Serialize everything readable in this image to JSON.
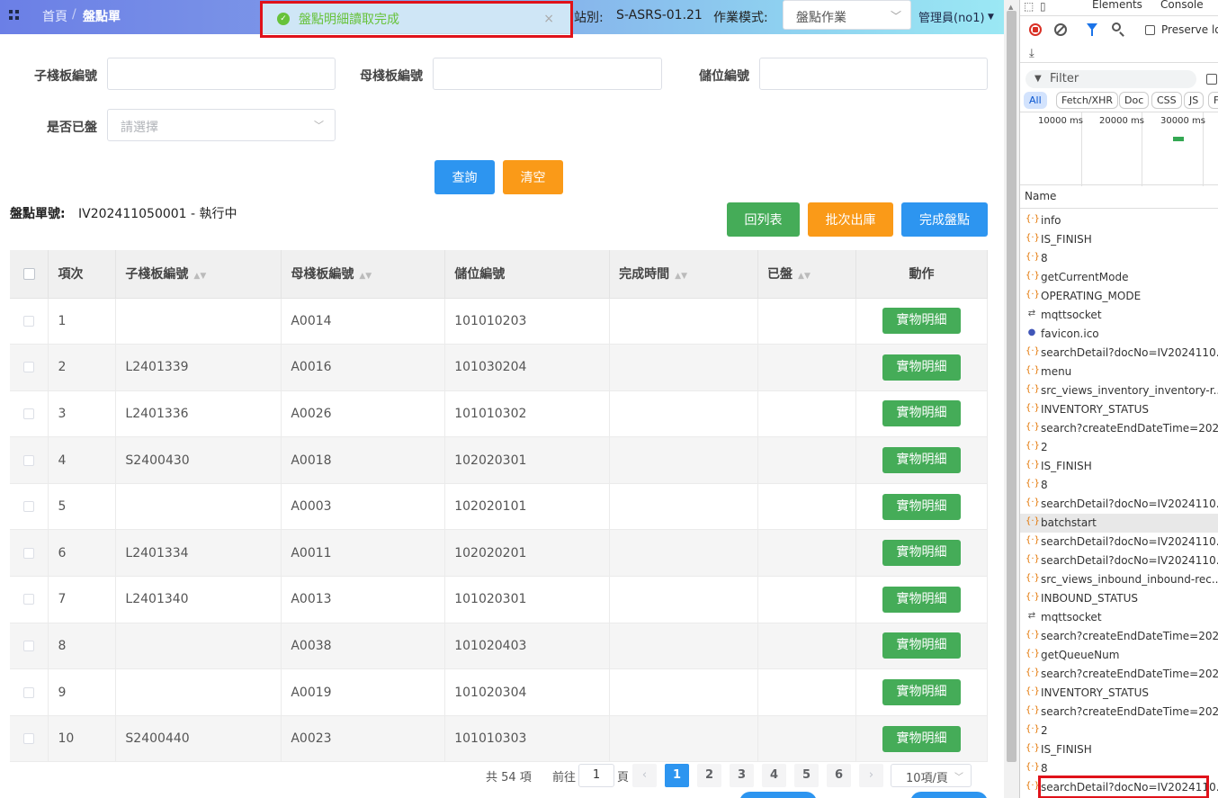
{
  "colors": {
    "primary": "#2d95f0",
    "success": "#45ac58",
    "warning": "#fa9a18",
    "highlight_outline": "#e0121a"
  },
  "header": {
    "menu_icon": "grid-icon",
    "breadcrumb": [
      "首頁",
      "/",
      "盤點單"
    ],
    "toast": {
      "icon": "check-circle-icon",
      "message": "盤點明細讀取完成",
      "close": "×"
    },
    "station_label": "站別:",
    "station_value": "S-ASRS-01.21",
    "mode_label": "作業模式:",
    "mode_value": "盤點作業",
    "user": "管理員(no1)"
  },
  "filters": {
    "child_board_label": "子棧板編號",
    "child_board_value": "",
    "parent_board_label": "母棧板編號",
    "parent_board_value": "",
    "location_label": "儲位編號",
    "location_value": "",
    "counted_label": "是否已盤",
    "counted_placeholder": "請選擇",
    "search_button": "查詢",
    "clear_button": "清空"
  },
  "order": {
    "label": "盤點單號:",
    "value": "IV202411050001 - 執行中",
    "back_button": "回列表",
    "batch_out_button": "批次出庫",
    "finish_button": "完成盤點"
  },
  "table": {
    "columns": [
      "項次",
      "子棧板編號",
      "母棧板編號",
      "儲位編號",
      "完成時間",
      "已盤",
      "動作"
    ],
    "action_label": "實物明細",
    "rows": [
      {
        "index": "1",
        "child": "",
        "parent": "A0014",
        "location": "101010203",
        "finished": "",
        "counted": ""
      },
      {
        "index": "2",
        "child": "L2401339",
        "parent": "A0016",
        "location": "101030204",
        "finished": "",
        "counted": ""
      },
      {
        "index": "3",
        "child": "L2401336",
        "parent": "A0026",
        "location": "101010302",
        "finished": "",
        "counted": ""
      },
      {
        "index": "4",
        "child": "S2400430",
        "parent": "A0018",
        "location": "102020301",
        "finished": "",
        "counted": ""
      },
      {
        "index": "5",
        "child": "",
        "parent": "A0003",
        "location": "102020101",
        "finished": "",
        "counted": ""
      },
      {
        "index": "6",
        "child": "L2401334",
        "parent": "A0011",
        "location": "102020201",
        "finished": "",
        "counted": ""
      },
      {
        "index": "7",
        "child": "L2401340",
        "parent": "A0013",
        "location": "101020301",
        "finished": "",
        "counted": ""
      },
      {
        "index": "8",
        "child": "",
        "parent": "A0038",
        "location": "101020403",
        "finished": "",
        "counted": ""
      },
      {
        "index": "9",
        "child": "",
        "parent": "A0019",
        "location": "101020304",
        "finished": "",
        "counted": ""
      },
      {
        "index": "10",
        "child": "S2400440",
        "parent": "A0023",
        "location": "101010303",
        "finished": "",
        "counted": ""
      }
    ]
  },
  "pagination": {
    "total": "共 54 項",
    "goto_label": "前往",
    "goto_value": "1",
    "page_unit": "頁",
    "pages": [
      "1",
      "2",
      "3",
      "4",
      "5",
      "6"
    ],
    "current_page": "1",
    "prev": "‹",
    "next": "›",
    "page_size": "10項/頁"
  },
  "devtools": {
    "tabs": [
      "Elements",
      "Console"
    ],
    "preserve_log": "Preserve log",
    "filter_placeholder": "Filter",
    "type_chips": [
      "All",
      "Fetch/XHR",
      "Doc",
      "CSS",
      "JS",
      "F"
    ],
    "timeline_ticks": [
      "10000 ms",
      "20000 ms",
      "30000 ms"
    ],
    "name_header": "Name",
    "requests": [
      {
        "name": "info",
        "icon": "xhr"
      },
      {
        "name": "IS_FINISH",
        "icon": "xhr"
      },
      {
        "name": "8",
        "icon": "xhr"
      },
      {
        "name": "getCurrentMode",
        "icon": "xhr"
      },
      {
        "name": "OPERATING_MODE",
        "icon": "xhr"
      },
      {
        "name": "mqttsocket",
        "icon": "ws"
      },
      {
        "name": "favicon.ico",
        "icon": "img"
      },
      {
        "name": "searchDetail?docNo=IV2024110...",
        "icon": "xhr"
      },
      {
        "name": "menu",
        "icon": "xhr"
      },
      {
        "name": "src_views_inventory_inventory-r...",
        "icon": "xhr"
      },
      {
        "name": "INVENTORY_STATUS",
        "icon": "xhr"
      },
      {
        "name": "search?createEndDateTime=202...",
        "icon": "xhr"
      },
      {
        "name": "2",
        "icon": "xhr"
      },
      {
        "name": "IS_FINISH",
        "icon": "xhr"
      },
      {
        "name": "8",
        "icon": "xhr"
      },
      {
        "name": "searchDetail?docNo=IV2024110...",
        "icon": "xhr"
      },
      {
        "name": "batchstart",
        "icon": "xhr"
      },
      {
        "name": "searchDetail?docNo=IV2024110...",
        "icon": "xhr"
      },
      {
        "name": "searchDetail?docNo=IV2024110...",
        "icon": "xhr"
      },
      {
        "name": "src_views_inbound_inbound-rec...",
        "icon": "xhr"
      },
      {
        "name": "INBOUND_STATUS",
        "icon": "xhr"
      },
      {
        "name": "mqttsocket",
        "icon": "ws"
      },
      {
        "name": "search?createEndDateTime=202...",
        "icon": "xhr"
      },
      {
        "name": "getQueueNum",
        "icon": "xhr"
      },
      {
        "name": "search?createEndDateTime=202...",
        "icon": "xhr"
      },
      {
        "name": "INVENTORY_STATUS",
        "icon": "xhr"
      },
      {
        "name": "search?createEndDateTime=202...",
        "icon": "xhr"
      },
      {
        "name": "2",
        "icon": "xhr"
      },
      {
        "name": "IS_FINISH",
        "icon": "xhr"
      },
      {
        "name": "8",
        "icon": "xhr"
      },
      {
        "name": "searchDetail?docNo=IV2024110...",
        "icon": "xhr"
      }
    ],
    "selected_request": "batchstart"
  }
}
